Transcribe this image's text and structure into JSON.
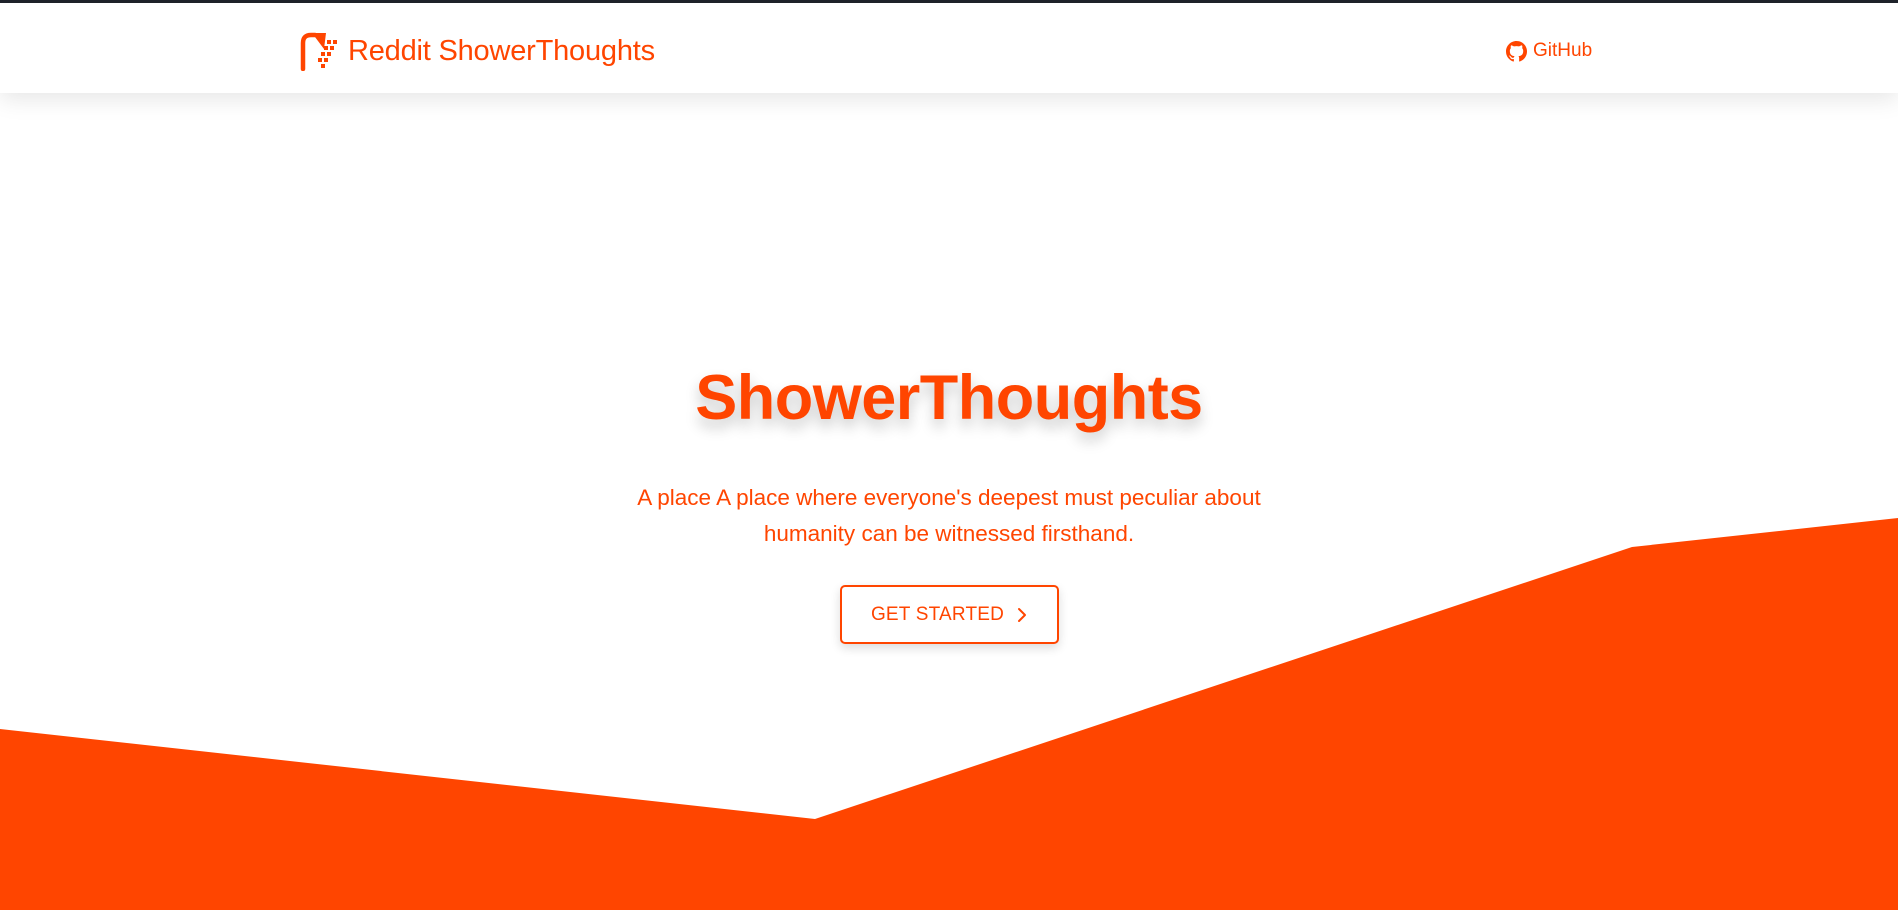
{
  "colors": {
    "brand": "#ff4500",
    "background": "#ffffff",
    "topline": "#1f232b"
  },
  "navbar": {
    "brand_text": "Reddit ShowerThoughts",
    "brand_icon": "shower-icon",
    "github_label": "GitHub",
    "github_icon": "github-icon"
  },
  "hero": {
    "title": "ShowerThoughts",
    "subtitle": "A place A place where everyone's deepest must peculiar about humanity can be witnessed firsthand.",
    "cta_label": "GET STARTED",
    "cta_icon": "chevron-right-icon"
  }
}
